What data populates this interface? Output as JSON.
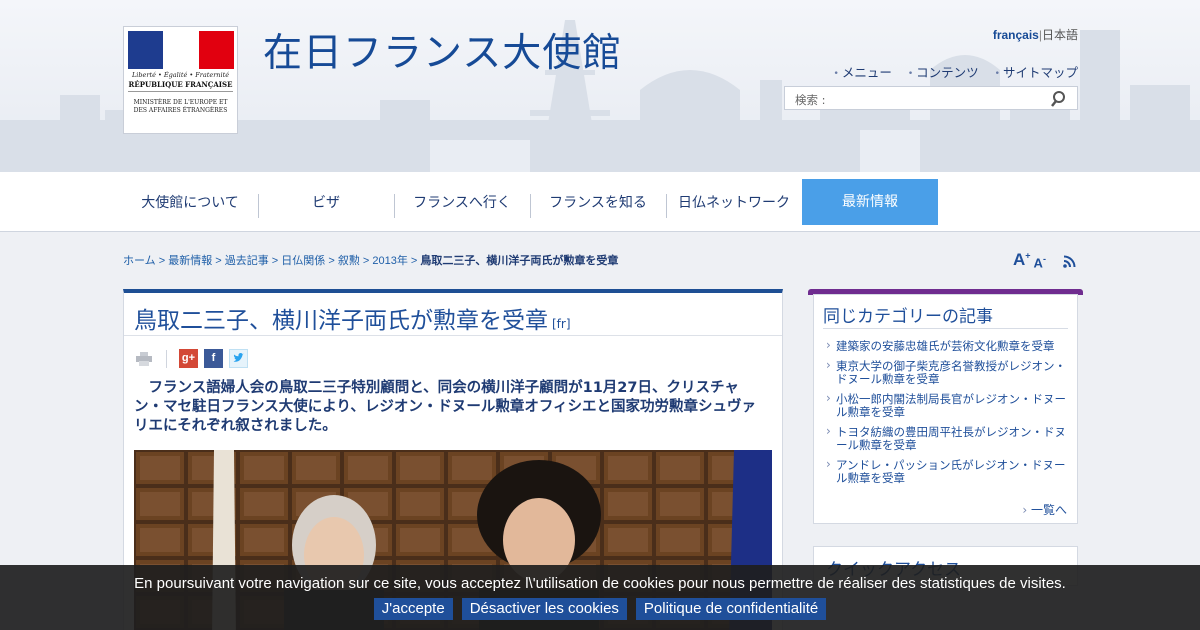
{
  "header": {
    "site_title": "在日フランス大使館",
    "logo": {
      "motto": "Liberté • Égalité • Fraternité",
      "republic": "RÉPUBLIQUE FRANÇAISE",
      "ministry": "MINISTÈRE DE L'EUROPE ET DES AFFAIRES ÉTRANGÈRES",
      "flag_colors": [
        "#1e3c8f",
        "#ffffff",
        "#e1000f"
      ]
    },
    "languages": {
      "french": "français",
      "separator": "|",
      "japanese": "日本語"
    },
    "top_links": [
      "メニュー",
      "コンテンツ",
      "サイトマップ"
    ],
    "search": {
      "placeholder": "検索 :",
      "icon": "search-icon"
    }
  },
  "nav": {
    "items": [
      "大使館について",
      "ビザ",
      "フランスへ行く",
      "フランスを知る",
      "日仏ネットワーク"
    ],
    "active": "最新情報"
  },
  "breadcrumb": {
    "trail": "ホーム > 最新情報 > 過去記事 > 日仏関係 > 叙勲 > 2013年 > ",
    "current": "鳥取二三子、横川洋子両氏が勲章を受章"
  },
  "tools": {
    "font_up": "A",
    "font_up_sign": "+",
    "font_down": "A",
    "font_down_sign": "-",
    "rss": "rss-icon"
  },
  "article": {
    "title": "鳥取二三子、横川洋子両氏が勲章を受章",
    "lang_tag": "[fr]",
    "share": {
      "print": "print-icon",
      "gplus": "g+",
      "facebook": "f",
      "twitter": "twitter-icon"
    },
    "lead": "　フランス語婦人会の鳥取二三子特別顧問と、同会の横川洋子顧問が11月27日、クリスチャン・マセ駐日フランス大使により、レジオン・ドヌール勲章オフィシエと国家功労勲章シュヴァリエにそれぞれ叙されました。"
  },
  "sidebar": {
    "heading": "同じカテゴリーの記事",
    "items": [
      "建築家の安藤忠雄氏が芸術文化勲章を受章",
      "東京大学の御子柴克彦名誉教授がレジオン・ドヌール勲章を受章",
      "小松一郎内閣法制局長官がレジオン・ドヌール勲章を受章",
      "トヨタ紡織の豊田周平社長がレジオン・ドヌール勲章を受章",
      "アンドレ・パッション氏がレジオン・ドヌール勲章を受章"
    ],
    "more": "一覧へ",
    "quick_access": "クイックアクセス"
  },
  "cookie": {
    "text": "En poursuivant votre navigation sur ce site, vous acceptez l\\'utilisation de cookies pour nous permettre de réaliser des statistiques de visites.",
    "accept": "J'accepte",
    "disable": "Désactiver les cookies",
    "privacy": "Politique de confidentialité"
  }
}
